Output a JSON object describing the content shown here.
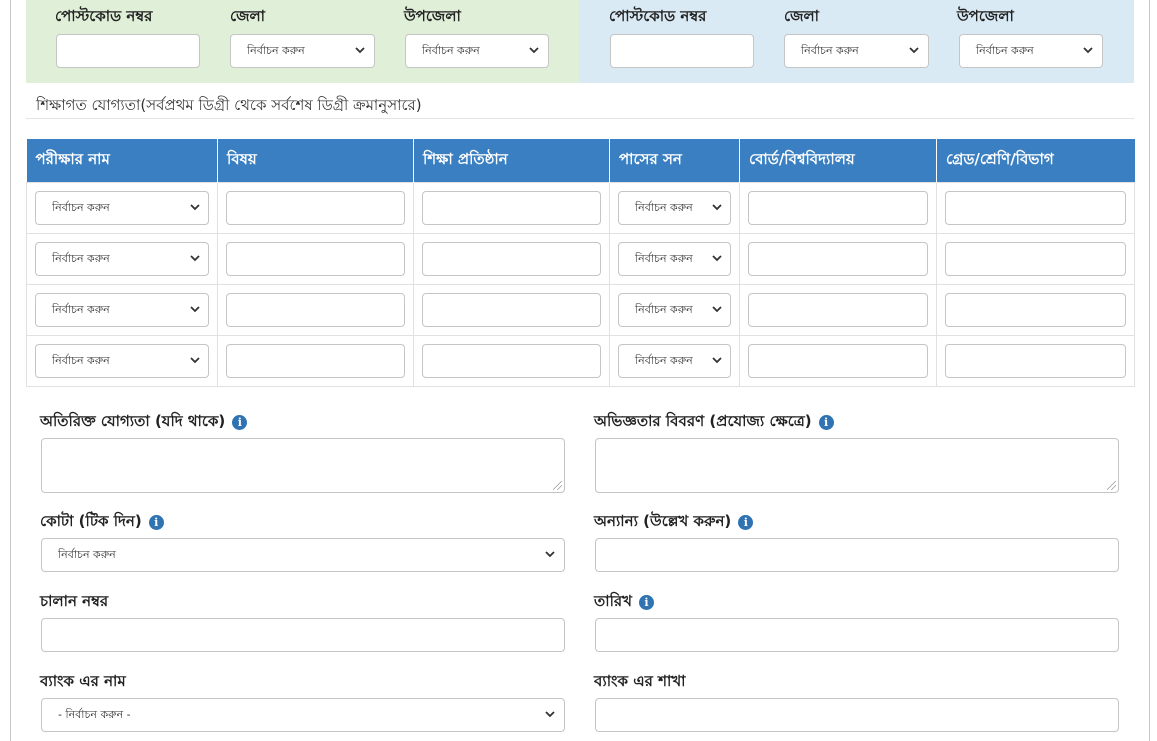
{
  "address": {
    "present": {
      "postcode_label": "পোস্টকোড নম্বর",
      "district_label": "জেলা",
      "district_value": "নির্বাচন করুন",
      "upazila_label": "উপজেলা",
      "upazila_value": "নির্বাচন করুন"
    },
    "permanent": {
      "postcode_label": "পোস্টকোড নম্বর",
      "district_label": "জেলা",
      "district_value": "নির্বাচন করুন",
      "upazila_label": "উপজেলা",
      "upazila_value": "নির্বাচন করুন"
    }
  },
  "education": {
    "title": "শিক্ষাগত যোগ্যতা(সর্বপ্রথম ডিগ্রী থেকে সর্বশেষ ডিগ্রী ক্রমানুসারে)",
    "columns": [
      "পরীক্ষার নাম",
      "বিষয়",
      "শিক্ষা প্রতিষ্ঠান",
      "পাসের সন",
      "বোর্ড/বিশ্ববিদ্যালয়",
      "গ্রেড/শ্রেণি/বিভাগ"
    ],
    "rows": [
      {
        "exam": "নির্বাচন করুন",
        "year": "নির্বাচন করুন"
      },
      {
        "exam": "নির্বাচন করুন",
        "year": "নির্বাচন করুন"
      },
      {
        "exam": "নির্বাচন করুন",
        "year": "নির্বাচন করুন"
      },
      {
        "exam": "নির্বাচন করুন",
        "year": "নির্বাচন করুন"
      }
    ]
  },
  "form": {
    "extra_qual_label": "অতিরিক্ত যোগ্যতা (যদি থাকে)",
    "experience_label": "অভিজ্ঞতার বিবরণ (প্রযোজ্য ক্ষেত্রে)",
    "quota_label": "কোটা (টিক দিন)",
    "quota_value": "নির্বাচন করুন",
    "other_label": "অন্যান্য (উল্লেখ করুন)",
    "challan_label": "চালান নম্বর",
    "date_label": "তারিখ",
    "bank_name_label": "ব্যাংক এর নাম",
    "bank_name_value": "- নির্বাচন করুন -",
    "bank_branch_label": "ব্যাংক এর শাখা",
    "info_icon": "i"
  }
}
